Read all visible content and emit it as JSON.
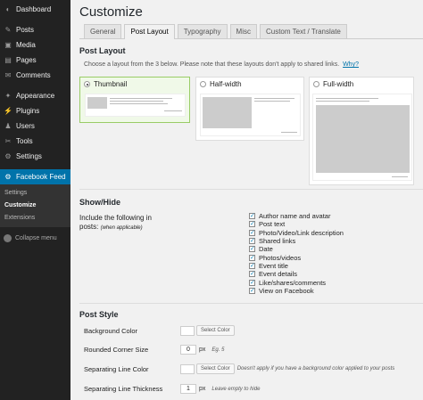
{
  "sidebar": {
    "items": [
      {
        "label": "Dashboard",
        "icon": "dashboard-icon",
        "glyph": "◐"
      },
      {
        "label": "Posts",
        "icon": "pin-icon",
        "glyph": "✎"
      },
      {
        "label": "Media",
        "icon": "media-icon",
        "glyph": "▣"
      },
      {
        "label": "Pages",
        "icon": "pages-icon",
        "glyph": "▤"
      },
      {
        "label": "Comments",
        "icon": "comments-icon",
        "glyph": "✉"
      },
      {
        "label": "Appearance",
        "icon": "appearance-icon",
        "glyph": "✦"
      },
      {
        "label": "Plugins",
        "icon": "plugins-icon",
        "glyph": "⚡"
      },
      {
        "label": "Users",
        "icon": "users-icon",
        "glyph": "♟"
      },
      {
        "label": "Tools",
        "icon": "tools-icon",
        "glyph": "✂"
      },
      {
        "label": "Settings",
        "icon": "settings-icon",
        "glyph": "⚙"
      },
      {
        "label": "Facebook Feed",
        "icon": "facebook-feed-icon",
        "glyph": "⚙"
      }
    ],
    "submenu": [
      "Settings",
      "Customize",
      "Extensions"
    ],
    "collapse": "Collapse menu"
  },
  "page": {
    "title": "Customize",
    "tabs": [
      "General",
      "Post Layout",
      "Typography",
      "Misc",
      "Custom Text / Translate"
    ]
  },
  "layout_section": {
    "title": "Post Layout",
    "desc": "Choose a layout from the 3 below. Please note that these layouts don't apply to shared links.",
    "why": "Why?",
    "options": [
      "Thumbnail",
      "Half-width",
      "Full-width"
    ],
    "preview_link": "View on Facebook"
  },
  "show_section": {
    "title": "Show/Hide",
    "label_line1": "Include the following in",
    "label_line2": "posts:",
    "label_hint": "(when applicable)",
    "items": [
      "Author name and avatar",
      "Post text",
      "Photo/Video/Link description",
      "Shared links",
      "Date",
      "Photos/videos",
      "Event title",
      "Event details",
      "Like/shares/comments",
      "View on Facebook"
    ]
  },
  "style_section": {
    "title": "Post Style",
    "background_label": "Background Color",
    "select_color": "Select Color",
    "corner_label": "Rounded Corner Size",
    "corner_value": "0",
    "px": "px",
    "corner_hint": "Eg. 5",
    "sep_color_label": "Separating Line Color",
    "sep_color_hint": "Doesn't apply if you have a background color applied to your posts",
    "sep_thick_label": "Separating Line Thickness",
    "sep_thick_value": "1",
    "sep_thick_hint": "Leave empty to hide"
  },
  "colors": {
    "sidebar": "#222222",
    "accent": "#0073aa",
    "selected_card": "#f0f9e8"
  }
}
